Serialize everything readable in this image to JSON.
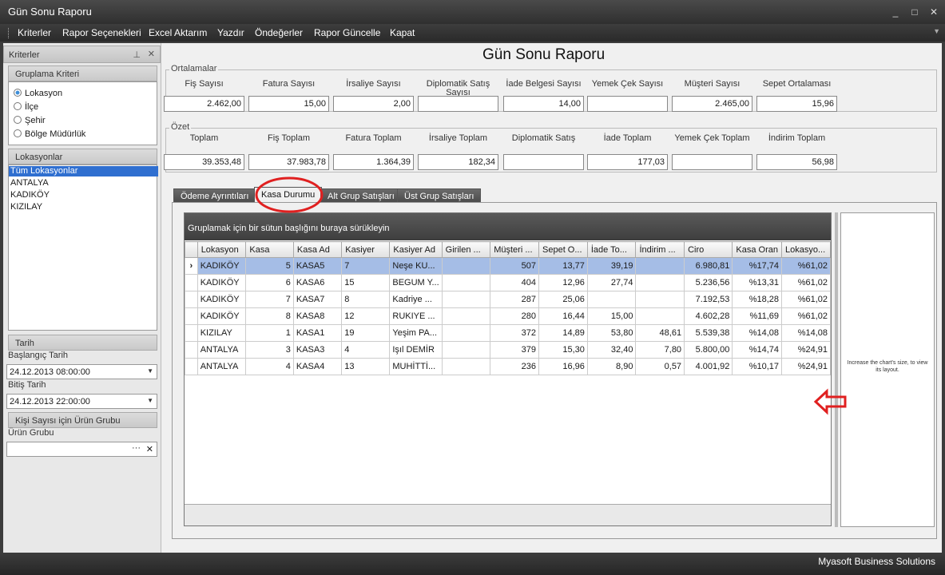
{
  "window": {
    "title": "Gün Sonu Raporu"
  },
  "menu": [
    "Kriterler",
    "Rapor Seçenekleri",
    "Excel Aktarım",
    "Yazdır",
    "Öndeğerler",
    "Rapor Güncelle",
    "Kapat"
  ],
  "left": {
    "panel_title": "Kriterler",
    "gruplama": {
      "title": "Gruplama Kriteri",
      "options": [
        "Lokasyon",
        "İlçe",
        "Şehir",
        "Bölge Müdürlük"
      ],
      "selected": "Lokasyon"
    },
    "lokasyonlar": {
      "title": "Lokasyonlar",
      "items": [
        "Tüm Lokasyonlar",
        "ANTALYA",
        "KADIKÖY",
        "KIZILAY"
      ],
      "selected": "Tüm Lokasyonlar"
    },
    "tarih": {
      "title": "Tarih",
      "start_label": "Başlangıç Tarih",
      "start_value": "24.12.2013 08:00:00",
      "end_label": "Bitiş Tarih",
      "end_value": "24.12.2013 22:00:00"
    },
    "urun": {
      "title": "Kişi Sayısı için Ürün Grubu",
      "label": "Ürün Grubu",
      "value": ""
    }
  },
  "report_title": "Gün Sonu Raporu",
  "ortalamalar": {
    "title": "Ortalamalar",
    "labels": [
      "Fiş Sayısı",
      "Fatura Sayısı",
      "İrsaliye Sayısı",
      "Diplomatik Satış Sayısı",
      "İade Belgesi Sayısı",
      "Yemek Çek Sayısı",
      "Müşteri Sayısı",
      "Sepet Ortalaması"
    ],
    "values": [
      "2.462,00",
      "15,00",
      "2,00",
      "",
      "14,00",
      "",
      "2.465,00",
      "15,96"
    ]
  },
  "ozet": {
    "title": "Özet",
    "labels": [
      "Toplam",
      "Fiş Toplam",
      "Fatura Toplam",
      "İrsaliye Toplam",
      "Diplomatik Satış",
      "İade Toplam",
      "Yemek Çek Toplam",
      "İndirim Toplam"
    ],
    "values": [
      "39.353,48",
      "37.983,78",
      "1.364,39",
      "182,34",
      "",
      "177,03",
      "",
      "56,98"
    ]
  },
  "tabs": [
    "Ödeme Ayrıntıları",
    "Kasa Durumu",
    "Alt Grup Satışları",
    "Üst Grup Satışları"
  ],
  "active_tab": "Kasa Durumu",
  "grid": {
    "group_hint": "Gruplamak için bir sütun başlığını buraya sürükleyin",
    "columns": [
      "Lokasyon",
      "Kasa",
      "Kasa Ad",
      "Kasiyer",
      "Kasiyer Ad",
      "Girilen ...",
      "Müşteri ...",
      "Sepet O...",
      "İade To...",
      "İndirim ...",
      "Ciro",
      "Kasa Oran",
      "Lokasyo..."
    ],
    "rows": [
      [
        "KADIKÖY",
        "5",
        "KASA5",
        "7",
        "Neşe KU...",
        "",
        "507",
        "13,77",
        "39,19",
        "",
        "6.980,81",
        "%17,74",
        "%61,02"
      ],
      [
        "KADIKÖY",
        "6",
        "KASA6",
        "15",
        "BEGUM Y...",
        "",
        "404",
        "12,96",
        "27,74",
        "",
        "5.236,56",
        "%13,31",
        "%61,02"
      ],
      [
        "KADIKÖY",
        "7",
        "KASA7",
        "8",
        "Kadriye ...",
        "",
        "287",
        "25,06",
        "",
        "",
        "7.192,53",
        "%18,28",
        "%61,02"
      ],
      [
        "KADIKÖY",
        "8",
        "KASA8",
        "12",
        "RUKIYE ...",
        "",
        "280",
        "16,44",
        "15,00",
        "",
        "4.602,28",
        "%11,69",
        "%61,02"
      ],
      [
        "KIZILAY",
        "1",
        "KASA1",
        "19",
        "Yeşim PA...",
        "",
        "372",
        "14,89",
        "53,80",
        "48,61",
        "5.539,38",
        "%14,08",
        "%14,08"
      ],
      [
        "ANTALYA",
        "3",
        "KASA3",
        "4",
        "Işıl DEMİR",
        "",
        "379",
        "15,30",
        "32,40",
        "7,80",
        "5.800,00",
        "%14,74",
        "%24,91"
      ],
      [
        "ANTALYA",
        "4",
        "KASA4",
        "13",
        "MUHİTTİ...",
        "",
        "236",
        "16,96",
        "8,90",
        "0,57",
        "4.001,92",
        "%10,17",
        "%24,91"
      ]
    ]
  },
  "chart_msg": "Increase the chart's size, to view its layout.",
  "status": "Myasoft Business Solutions",
  "colors": {
    "accent": "#2f6fd0",
    "selected_row": "#a5bde6",
    "annotation": "#e02020"
  }
}
